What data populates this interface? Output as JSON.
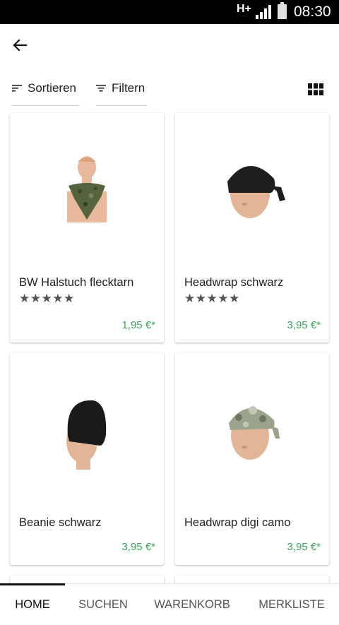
{
  "status_bar": {
    "network": "H+",
    "time": "08:30"
  },
  "toolbar": {
    "sort_label": "Sortieren",
    "filter_label": "Filtern"
  },
  "products": [
    {
      "name": "BW Halstuch flecktarn",
      "rating": "★★★★★",
      "price": "1,95 €*"
    },
    {
      "name": "Headwrap schwarz",
      "rating": "★★★★★",
      "price": "3,95 €*"
    },
    {
      "name": "Beanie schwarz",
      "rating": "",
      "price": "3,95 €*"
    },
    {
      "name": "Headwrap digi camo",
      "rating": "",
      "price": "3,95 €*"
    }
  ],
  "bottom_nav": {
    "home": "HOME",
    "search": "SUCHEN",
    "cart": "WARENKORB",
    "wishlist": "MERKLISTE"
  },
  "colors": {
    "price": "#3aa55b",
    "status_bar": "#000000",
    "text": "#212121"
  }
}
